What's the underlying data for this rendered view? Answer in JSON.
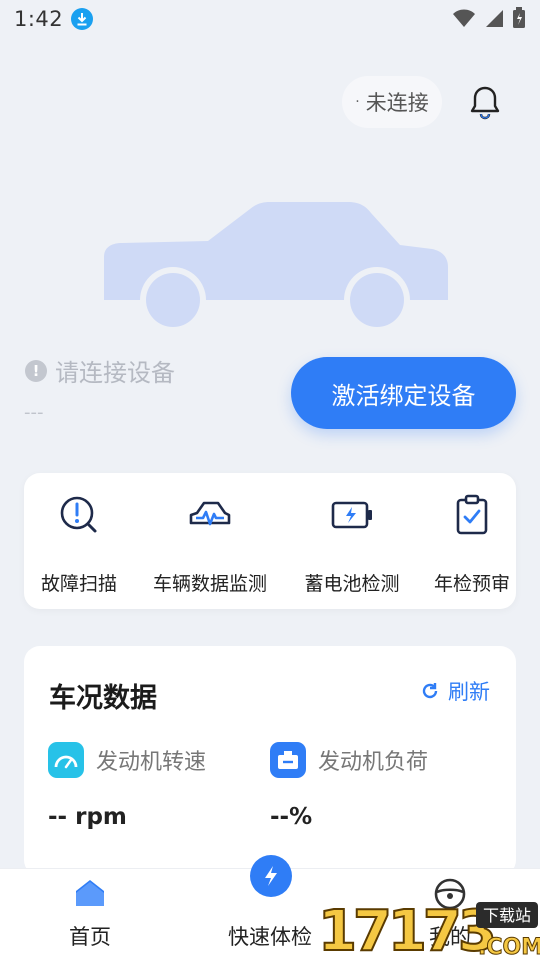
{
  "status_bar": {
    "time": "1:42"
  },
  "header": {
    "connection_status": "未连接"
  },
  "device": {
    "warning_text": "请连接设备",
    "placeholder_dash": "---",
    "activate_button": "激活绑定设备"
  },
  "tools": [
    {
      "label": "故障扫描",
      "icon": "fault-scan-icon"
    },
    {
      "label": "车辆数据监测",
      "icon": "vehicle-monitor-icon"
    },
    {
      "label": "蓄电池检测",
      "icon": "battery-check-icon"
    },
    {
      "label": "年检预审",
      "icon": "inspection-clipboard-icon"
    }
  ],
  "conditions": {
    "title": "车况数据",
    "refresh_label": "刷新",
    "metrics": [
      {
        "label": "发动机转速",
        "value": "-- rpm",
        "icon": "speedometer-icon",
        "color": "#27c2e8"
      },
      {
        "label": "发动机负荷",
        "value": "--%",
        "icon": "engine-load-icon",
        "color": "#2f7df6"
      }
    ]
  },
  "nav": [
    {
      "label": "首页",
      "icon": "home-icon"
    },
    {
      "label": "快速体检",
      "icon": "lightning-icon"
    },
    {
      "label": "我的",
      "icon": "steering-wheel-icon"
    }
  ],
  "watermark": {
    "number": "17173",
    "site": "下载站",
    "domain": ".COM"
  },
  "colors": {
    "accent": "#2f7df6",
    "background": "#eef1f6",
    "car_illustration": "#cfdaf6"
  }
}
